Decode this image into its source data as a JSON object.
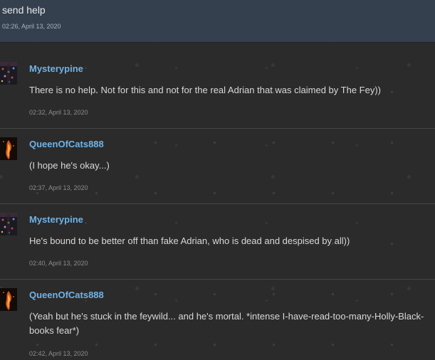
{
  "op": {
    "text": "send help",
    "timestamp": "02:26, April 13, 2020"
  },
  "comments": [
    {
      "author": "Mysterypine",
      "avatar": "pine-avatar",
      "text": "There is no help. Not for this and not for the real Adrian that was claimed by The Fey))",
      "timestamp": "02:32, April 13, 2020"
    },
    {
      "author": "QueenOfCats888",
      "avatar": "flame-avatar",
      "text": "(I hope he's okay...)",
      "timestamp": "02:37, April 13, 2020"
    },
    {
      "author": "Mysterypine",
      "avatar": "pine-avatar",
      "text": "He's bound to be better off than fake Adrian, who is dead and despised by all))",
      "timestamp": "02:40, April 13, 2020"
    },
    {
      "author": "QueenOfCats888",
      "avatar": "flame-avatar",
      "text": "(Yeah but he's stuck in the feywild... and he's mortal. *intense I-have-read-too-many-Holly-Black-books fear*)",
      "timestamp": "02:42, April 13, 2020"
    }
  ]
}
